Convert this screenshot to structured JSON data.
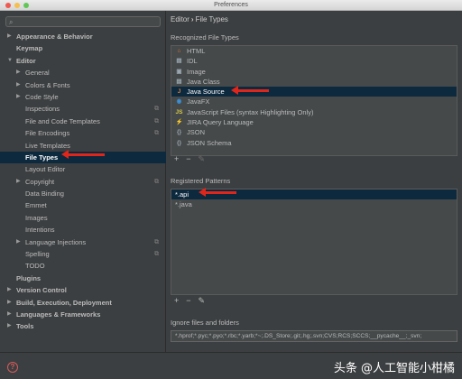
{
  "window": {
    "title": "Preferences"
  },
  "search": {
    "placeholder": ""
  },
  "tree": [
    {
      "label": "Appearance & Behavior",
      "level": 0,
      "arrow": "▶",
      "bold": true
    },
    {
      "label": "Keymap",
      "level": 0,
      "arrow": "",
      "bold": true
    },
    {
      "label": "Editor",
      "level": 0,
      "arrow": "▼",
      "bold": true
    },
    {
      "label": "General",
      "level": 1,
      "arrow": "▶"
    },
    {
      "label": "Colors & Fonts",
      "level": 1,
      "arrow": "▶"
    },
    {
      "label": "Code Style",
      "level": 1,
      "arrow": "▶"
    },
    {
      "label": "Inspections",
      "level": 1,
      "arrow": "",
      "gear": true
    },
    {
      "label": "File and Code Templates",
      "level": 1,
      "arrow": "",
      "gear": true
    },
    {
      "label": "File Encodings",
      "level": 1,
      "arrow": "",
      "gear": true
    },
    {
      "label": "Live Templates",
      "level": 1,
      "arrow": ""
    },
    {
      "label": "File Types",
      "level": 1,
      "arrow": "",
      "selected": true
    },
    {
      "label": "Layout Editor",
      "level": 1,
      "arrow": ""
    },
    {
      "label": "Copyright",
      "level": 1,
      "arrow": "▶",
      "gear": true
    },
    {
      "label": "Data Binding",
      "level": 1,
      "arrow": ""
    },
    {
      "label": "Emmet",
      "level": 1,
      "arrow": ""
    },
    {
      "label": "Images",
      "level": 1,
      "arrow": ""
    },
    {
      "label": "Intentions",
      "level": 1,
      "arrow": ""
    },
    {
      "label": "Language Injections",
      "level": 1,
      "arrow": "▶",
      "gear": true
    },
    {
      "label": "Spelling",
      "level": 1,
      "arrow": "",
      "gear": true
    },
    {
      "label": "TODO",
      "level": 1,
      "arrow": ""
    },
    {
      "label": "Plugins",
      "level": 0,
      "arrow": "",
      "bold": true
    },
    {
      "label": "Version Control",
      "level": 0,
      "arrow": "▶",
      "bold": true
    },
    {
      "label": "Build, Execution, Deployment",
      "level": 0,
      "arrow": "▶",
      "bold": true
    },
    {
      "label": "Languages & Frameworks",
      "level": 0,
      "arrow": "▶",
      "bold": true
    },
    {
      "label": "Tools",
      "level": 0,
      "arrow": "▶",
      "bold": true
    }
  ],
  "breadcrumb": {
    "parent": "Editor",
    "separator": "›",
    "current": "File Types"
  },
  "recognized": {
    "label": "Recognized File Types",
    "items": [
      {
        "label": "HTML",
        "icon": "html-icon",
        "glyph": "⌂",
        "color": "#e2763a"
      },
      {
        "label": "IDL",
        "icon": "file-icon",
        "glyph": "▤",
        "color": "#9aa7b0"
      },
      {
        "label": "Image",
        "icon": "image-icon",
        "glyph": "▣",
        "color": "#9aa7b0"
      },
      {
        "label": "Java Class",
        "icon": "class-icon",
        "glyph": "▤",
        "color": "#9aa7b0"
      },
      {
        "label": "Java Source",
        "icon": "java-icon",
        "glyph": "J",
        "color": "#d8803a",
        "selected": true
      },
      {
        "label": "JavaFX",
        "icon": "javafx-icon",
        "glyph": "◉",
        "color": "#3b8fd6"
      },
      {
        "label": "JavaScript Files (syntax Highlighting Only)",
        "icon": "js-icon",
        "glyph": "JS",
        "color": "#d7c74a"
      },
      {
        "label": "JIRA Query Language",
        "icon": "jira-icon",
        "glyph": "⚡",
        "color": "#9aa7b0"
      },
      {
        "label": "JSON",
        "icon": "json-icon",
        "glyph": "{}",
        "color": "#9aa7b0"
      },
      {
        "label": "JSON Schema",
        "icon": "json-schema-icon",
        "glyph": "{}",
        "color": "#9aa7b0"
      }
    ]
  },
  "patterns": {
    "label": "Registered Patterns",
    "items": [
      {
        "label": "*.api",
        "selected": true
      },
      {
        "label": "*.java"
      }
    ]
  },
  "toolbar": {
    "add": "+",
    "remove": "−",
    "edit": "✎"
  },
  "ignore": {
    "label": "Ignore files and folders",
    "value": "*.hprof;*.pyc;*.pyo;*.rbc;*.yarb;*~;.DS_Store;.git;.hg;.svn;CVS;RCS;SCCS;__pycache__;_svn;"
  },
  "footer": {
    "help": "?",
    "watermark": "头条 @人工智能小柑橘"
  },
  "colors": {
    "selection": "#0d293e",
    "arrow": "#e0261b",
    "background": "#3c3f41"
  }
}
